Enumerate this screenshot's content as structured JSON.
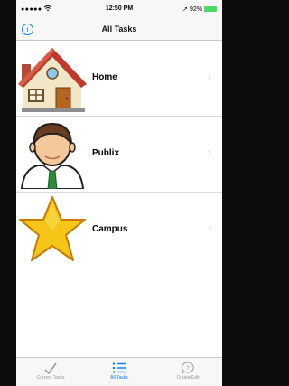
{
  "status_bar": {
    "signal": "●●●●● ",
    "time": "12:50 PM",
    "battery_text": "➚ 92%",
    "battery_color": "#4cd964"
  },
  "nav": {
    "title": "All Tasks",
    "info_glyph": "i",
    "info_icon": "info-icon"
  },
  "tasks": [
    {
      "label": "Home",
      "icon": "house-icon"
    },
    {
      "label": "Publix",
      "icon": "person-icon"
    },
    {
      "label": "Campus",
      "icon": "star-icon"
    }
  ],
  "chevron": "›",
  "tabs": [
    {
      "label": "Current Tasks",
      "icon": "checkmark-icon",
      "active": false
    },
    {
      "label": "All Tasks",
      "icon": "list-icon",
      "active": true
    },
    {
      "label": "Create/Edit",
      "icon": "speech-bubble-icon",
      "active": false
    }
  ],
  "accent_color": "#007aff"
}
